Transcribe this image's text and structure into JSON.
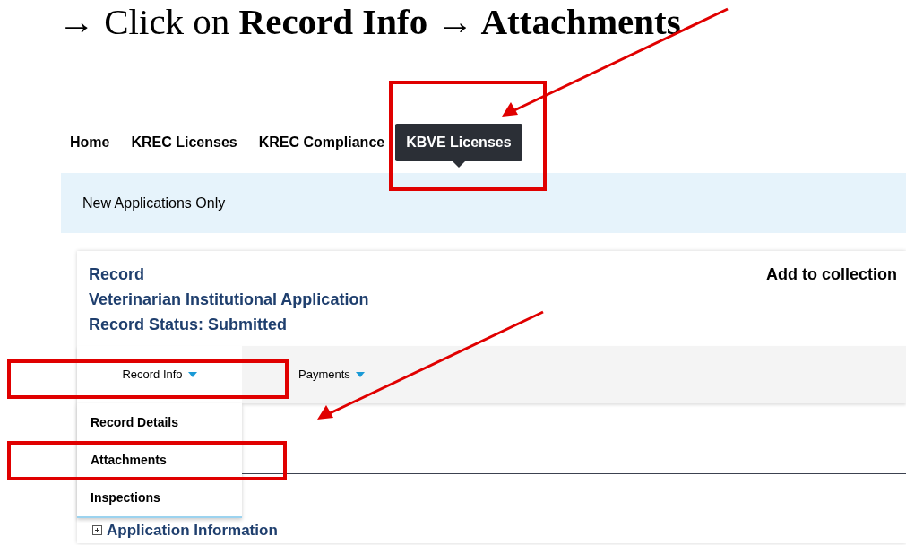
{
  "instruction": "→ Click on **Record Info → Attachments**",
  "nav_tabs": [
    {
      "label": "Home",
      "selected": false,
      "callout": false
    },
    {
      "label": "KREC Licenses",
      "selected": false,
      "callout": false
    },
    {
      "label": "KREC Compliance",
      "selected": false,
      "callout": false
    },
    {
      "label": "KBVE Licenses",
      "selected": true,
      "callout": true
    }
  ],
  "banner": {
    "text": "New Applications Only"
  },
  "record": {
    "title": "Record",
    "type": "Veterinarian Institutional Application",
    "status": "Record Status: Submitted",
    "action": "Add to collection"
  },
  "menu_tabs": [
    {
      "label": "Record Info",
      "expanded": true,
      "callout": true
    },
    {
      "label": "Payments",
      "expanded": false,
      "callout": false
    }
  ],
  "dropdown_items": [
    {
      "label": "Record Details",
      "callout": false
    },
    {
      "label": "Attachments",
      "callout": true
    },
    {
      "label": "Inspections",
      "callout": false
    }
  ],
  "section": {
    "label": "Application Information",
    "expanded": false
  }
}
